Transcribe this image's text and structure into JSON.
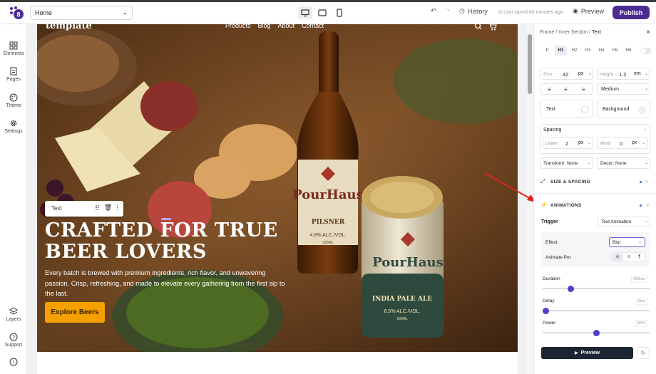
{
  "topbar": {
    "page_select": "Home",
    "history_label": "History",
    "saved_text": "Last saved 40 minutes ago",
    "preview_label": "Preview",
    "publish_label": "Publish",
    "brand_color": "#4b2c91"
  },
  "left_sidebar": {
    "items": [
      {
        "label": "Elements",
        "icon": "grid-icon"
      },
      {
        "label": "Pages",
        "icon": "page-icon"
      },
      {
        "label": "Theme",
        "icon": "palette-icon"
      },
      {
        "label": "Settings",
        "icon": "gear-icon"
      },
      {
        "label": "Layers",
        "icon": "layers-icon"
      },
      {
        "label": "Support",
        "icon": "help-icon"
      },
      {
        "label": "",
        "icon": "info-icon"
      }
    ]
  },
  "canvas": {
    "site_logo": "template",
    "nav": [
      "Products",
      "Blog",
      "About",
      "Contact"
    ],
    "text_tool_label": "Text",
    "headline_1": "CRAFTED FOR TRUE",
    "headline_2": "BEER LOVERS",
    "body": "Every batch is brewed with premium ingredients, rich flavor, and unwavering passion. Crisp, refreshing, and made to elevate every gathering from the first sip to the last.",
    "cta": "Explore Beers",
    "bottle_brand": "PourHaus",
    "bottle_type": "PILSNER",
    "bottle_abv": "4.8% ALC./VOL.",
    "bottle_vol": "330ML",
    "can_brand": "PourHaus",
    "can_type": "INDIA PALE ALE",
    "can_abv": "6.5% ALC./VOL.",
    "can_vol": "330ML",
    "accent": "#f4a100"
  },
  "panel": {
    "breadcrumb": [
      "Frame",
      "Inner Section",
      "Text"
    ],
    "tags": [
      "P",
      "H1",
      "H2",
      "H3",
      "H4",
      "H5",
      "H6"
    ],
    "size_label": "Size",
    "size_value": "42",
    "size_unit": "px",
    "height_label": "Height",
    "height_value": "1.2",
    "height_unit": "em",
    "weight": "Medium",
    "text_label": "Text",
    "background_label": "Background",
    "spacing_label": "Spacing",
    "letter_label": "Letter",
    "letter_value": "2",
    "letter_unit": "px",
    "word_label": "Word",
    "word_value": "0",
    "word_unit": "px",
    "transform": "Transform: None",
    "decor": "Decor: None",
    "size_spacing_title": "SIZE & SPACING",
    "animations_title": "ANIMATIONS",
    "trigger_label": "Trigger",
    "trigger_value": "Text Animation",
    "effect_label": "Effect",
    "effect_value": "Blur",
    "animate_per_label": "Animate Per",
    "animate_per_options": [
      "A",
      "≡",
      "¶"
    ],
    "duration_label": "Duration",
    "duration_value": "300ms",
    "duration_fraction": 0.25,
    "delay_label": "Delay",
    "delay_value": "0ms",
    "delay_fraction": 0.0,
    "power_label": "Power",
    "power_value": "50%",
    "power_fraction": 0.5,
    "preview_label": "Preview"
  }
}
